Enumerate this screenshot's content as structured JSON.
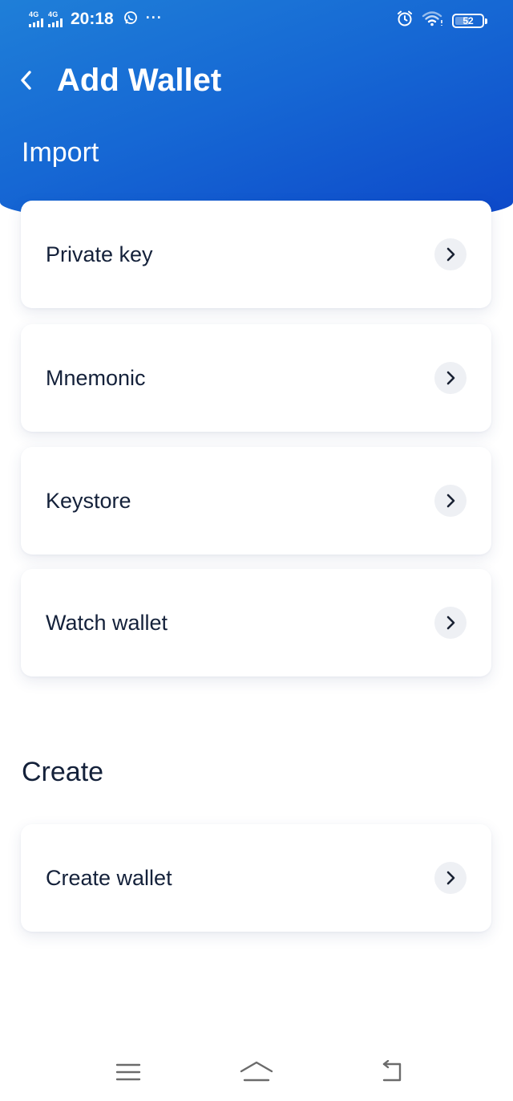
{
  "status_bar": {
    "network_1": "4G",
    "network_2": "4G",
    "time": "20:18",
    "more": "···",
    "battery_level": "52",
    "battery_fraction": 0.52,
    "icons": [
      "signal-icon",
      "whatsapp-icon",
      "alarm-icon",
      "wifi-icon",
      "battery-icon"
    ]
  },
  "header": {
    "title": "Add Wallet",
    "back_icon": "chevron-left-icon"
  },
  "import_section": {
    "title": "Import",
    "items": [
      {
        "label": "Private key",
        "icon": "chevron-right-icon"
      },
      {
        "label": "Mnemonic",
        "icon": "chevron-right-icon"
      },
      {
        "label": "Keystore",
        "icon": "chevron-right-icon"
      },
      {
        "label": "Watch wallet",
        "icon": "chevron-right-icon"
      }
    ]
  },
  "create_section": {
    "title": "Create",
    "items": [
      {
        "label": "Create wallet",
        "icon": "chevron-right-icon"
      }
    ]
  },
  "nav_bar": {
    "icons": [
      "menu-icon",
      "home-icon",
      "back-nav-icon"
    ]
  },
  "colors": {
    "header_start": "#1f7fd8",
    "header_end": "#0d47c9",
    "text_dark": "#14213a",
    "chevron_bg": "#eef0f4"
  }
}
